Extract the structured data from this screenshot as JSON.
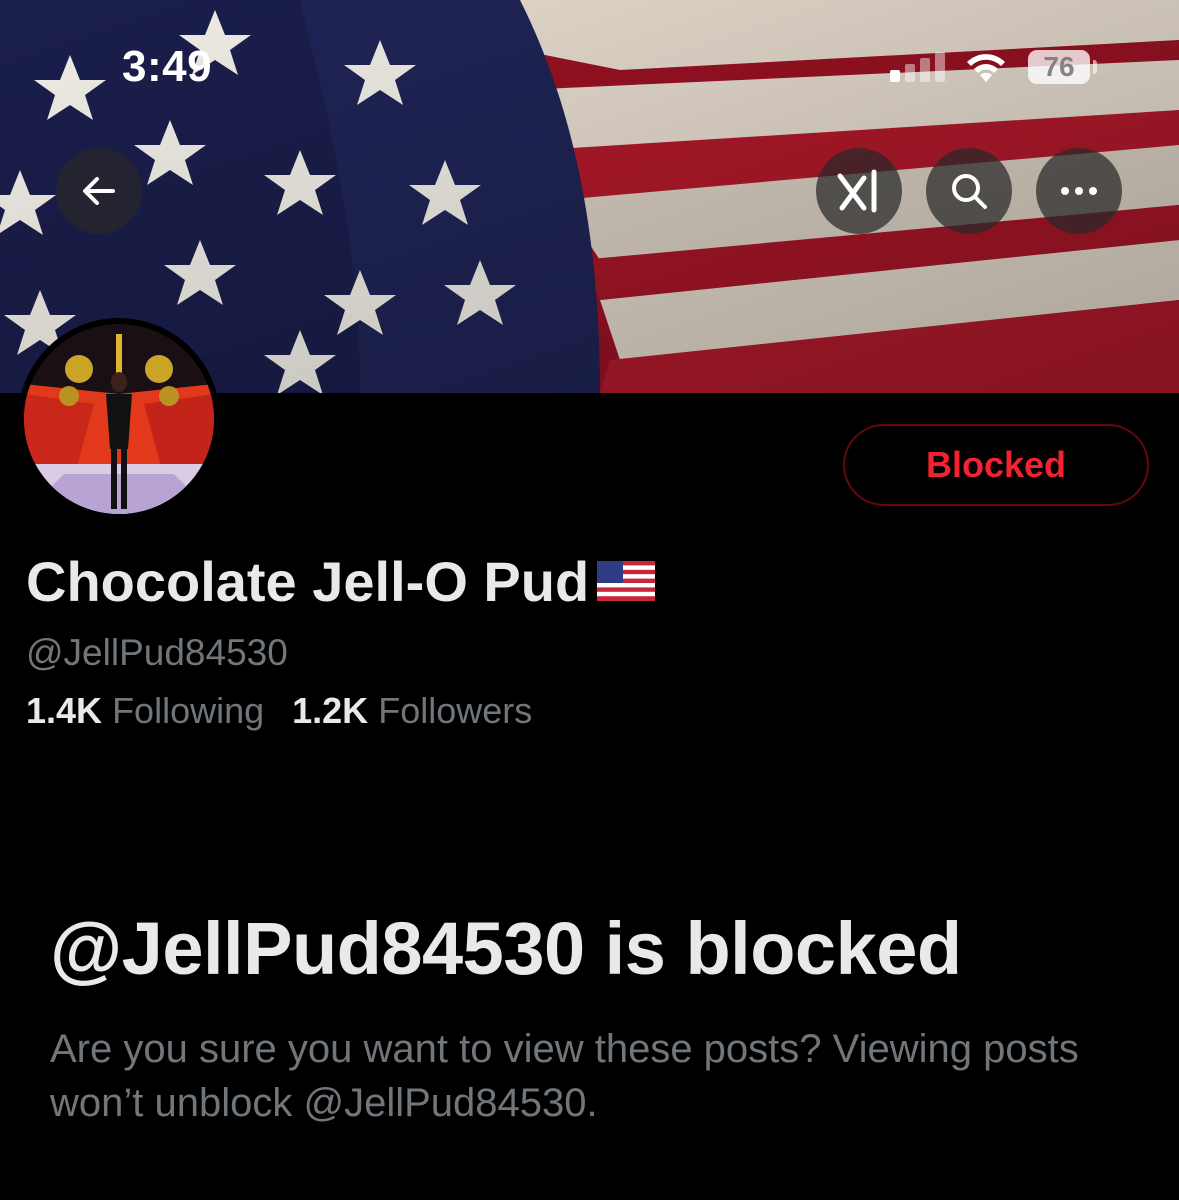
{
  "status_bar": {
    "time": "3:49",
    "battery_level": "76",
    "signal_icon": "cellular-signal-icon",
    "wifi_icon": "wifi-icon"
  },
  "header": {
    "back_icon": "arrow-left-icon",
    "grok_icon": "grok-icon",
    "search_icon": "search-icon",
    "more_icon": "more-horizontal-icon"
  },
  "banner": {
    "image": "american-flag-banner"
  },
  "profile": {
    "avatar": "profile-avatar",
    "display_name": "Chocolate Jell-O Pud",
    "name_emoji": "🇺🇸",
    "handle": "@JellPud84530",
    "following_count": "1.4K",
    "following_label": "Following",
    "followers_count": "1.2K",
    "followers_label": "Followers",
    "blocked_button_label": "Blocked"
  },
  "blocked_notice": {
    "title": "@JellPud84530 is blocked",
    "description": "Are you sure you want to view these posts? Viewing posts won’t unblock @JellPud84530."
  },
  "colors": {
    "background": "#000000",
    "primary_text": "#e7e9ea",
    "secondary_text": "#71767b",
    "blocked_red": "#f4212e"
  }
}
